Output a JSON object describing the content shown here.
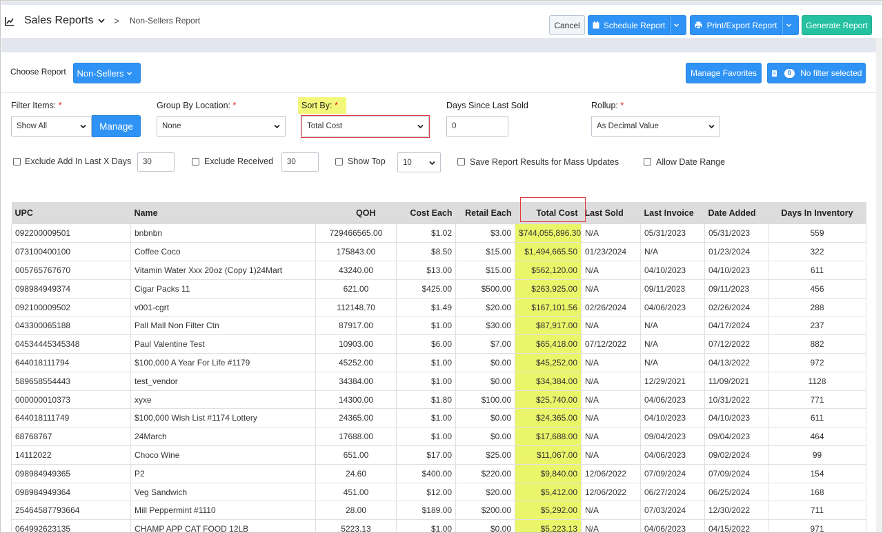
{
  "header": {
    "title": "Sales Reports",
    "breadcrumb_sep": ">",
    "breadcrumb": "Non-Sellers Report",
    "cancel": "Cancel",
    "schedule": "Schedule Report",
    "print": "Print/Export Report",
    "generate": "Generate Report"
  },
  "toolbar": {
    "choose_label": "Choose Report",
    "report_button": "Non-Sellers",
    "favorites": "Manage Favorites",
    "filter_count": "0",
    "filter_text": "No filter selected"
  },
  "filters": {
    "filter_items": {
      "label": "Filter Items:",
      "value": "Show All",
      "manage": "Manage"
    },
    "group_by": {
      "label": "Group By Location:",
      "value": "None"
    },
    "sort_by": {
      "label": "Sort By:",
      "value": "Total Cost"
    },
    "days_since": {
      "label": "Days Since Last Sold",
      "value": "0"
    },
    "rollup": {
      "label": "Rollup:",
      "value": "As Decimal Value"
    },
    "required_mark": "*"
  },
  "options": {
    "exclude_add": {
      "label": "Exclude Add In Last X Days",
      "value": "30"
    },
    "exclude_received": {
      "label": "Exclude Received",
      "value": "30"
    },
    "show_top": {
      "label": "Show Top",
      "value": "10"
    },
    "save_results": {
      "label": "Save Report Results for Mass Updates"
    },
    "allow_date": {
      "label": "Allow Date Range"
    }
  },
  "table": {
    "columns": [
      "UPC",
      "Name",
      "QOH",
      "Cost Each",
      "Retail Each",
      "Total Cost",
      "Last Sold",
      "Last Invoice",
      "Date Added",
      "Days In Inventory"
    ],
    "rows": [
      [
        "092200009501",
        "bnbnbn",
        "729466565.00",
        "$1.02",
        "$3.00",
        "$744,055,896.30",
        "N/A",
        "05/31/2023",
        "05/31/2023",
        "559"
      ],
      [
        "073100400100",
        "Coffee Coco",
        "175843.00",
        "$8.50",
        "$15.00",
        "$1,494,665.50",
        "01/23/2024",
        "N/A",
        "01/23/2024",
        "322"
      ],
      [
        "005765767670",
        "Vitamin Water Xxx 20oz (Copy 1)24Mart",
        "43240.00",
        "$13.00",
        "$15.00",
        "$562,120.00",
        "N/A",
        "04/10/2023",
        "04/10/2023",
        "611"
      ],
      [
        "098984949374",
        "Cigar Packs 11",
        "621.00",
        "$425.00",
        "$500.00",
        "$263,925.00",
        "N/A",
        "09/11/2023",
        "09/11/2023",
        "456"
      ],
      [
        "092100009502",
        "v001-cgrt",
        "112148.70",
        "$1.49",
        "$20.00",
        "$167,101.56",
        "02/26/2024",
        "04/06/2023",
        "02/26/2024",
        "288"
      ],
      [
        "043300065188",
        "Pall Mall Non Filter Ctn",
        "87917.00",
        "$1.00",
        "$30.00",
        "$87,917.00",
        "N/A",
        "N/A",
        "04/17/2024",
        "237"
      ],
      [
        "04534445345348",
        "Paul Valentine Test",
        "10903.00",
        "$6.00",
        "$7.00",
        "$65,418.00",
        "07/12/2022",
        "N/A",
        "07/12/2022",
        "882"
      ],
      [
        "644018111794",
        "$100,000 A Year For Life #1179",
        "45252.00",
        "$1.00",
        "$0.00",
        "$45,252.00",
        "N/A",
        "N/A",
        "04/13/2022",
        "972"
      ],
      [
        "589658554443",
        "test_vendor",
        "34384.00",
        "$1.00",
        "$0.00",
        "$34,384.00",
        "N/A",
        "12/29/2021",
        "11/09/2021",
        "1128"
      ],
      [
        "000000010373",
        "xyxe",
        "14300.00",
        "$1.80",
        "$100.00",
        "$25,740.00",
        "N/A",
        "04/06/2023",
        "10/31/2022",
        "771"
      ],
      [
        "644018111749",
        "$100,000 Wish List #1174 Lottery",
        "24365.00",
        "$1.00",
        "$0.00",
        "$24,365.00",
        "N/A",
        "04/10/2023",
        "04/10/2023",
        "611"
      ],
      [
        "68768767",
        "24March",
        "17688.00",
        "$1.00",
        "$0.00",
        "$17,688.00",
        "N/A",
        "09/04/2023",
        "09/04/2023",
        "464"
      ],
      [
        "14112022",
        "Choco Wine",
        "651.00",
        "$17.00",
        "$25.00",
        "$11,067.00",
        "N/A",
        "04/06/2023",
        "09/02/2024",
        "99"
      ],
      [
        "098984949365",
        "P2",
        "24.60",
        "$400.00",
        "$220.00",
        "$9,840.00",
        "12/06/2022",
        "07/09/2024",
        "07/09/2024",
        "154"
      ],
      [
        "098984949364",
        "Veg Sandwich",
        "451.00",
        "$12.00",
        "$20.00",
        "$5,412.00",
        "12/06/2022",
        "06/27/2024",
        "06/25/2024",
        "168"
      ],
      [
        "25464587793664",
        "Mill Peppermint #1110",
        "28.00",
        "$189.00",
        "$200.00",
        "$5,292.00",
        "N/A",
        "07/03/2024",
        "12/30/2022",
        "711"
      ],
      [
        "064992623135",
        "CHAMP APP CAT FOOD 12LB",
        "5223.13",
        "$1.00",
        "$0.00",
        "$5,223.13",
        "N/A",
        "04/06/2023",
        "04/15/2022",
        "971"
      ]
    ]
  },
  "colors": {
    "primary": "#2f93f5",
    "success": "#25c1a1",
    "highlight": "#ebf56a",
    "annotation": "#e0393e"
  },
  "icons": {
    "title": "line-chart-icon",
    "schedule": "calendar-icon",
    "print": "printer-icon",
    "filter": "filter-icon"
  }
}
